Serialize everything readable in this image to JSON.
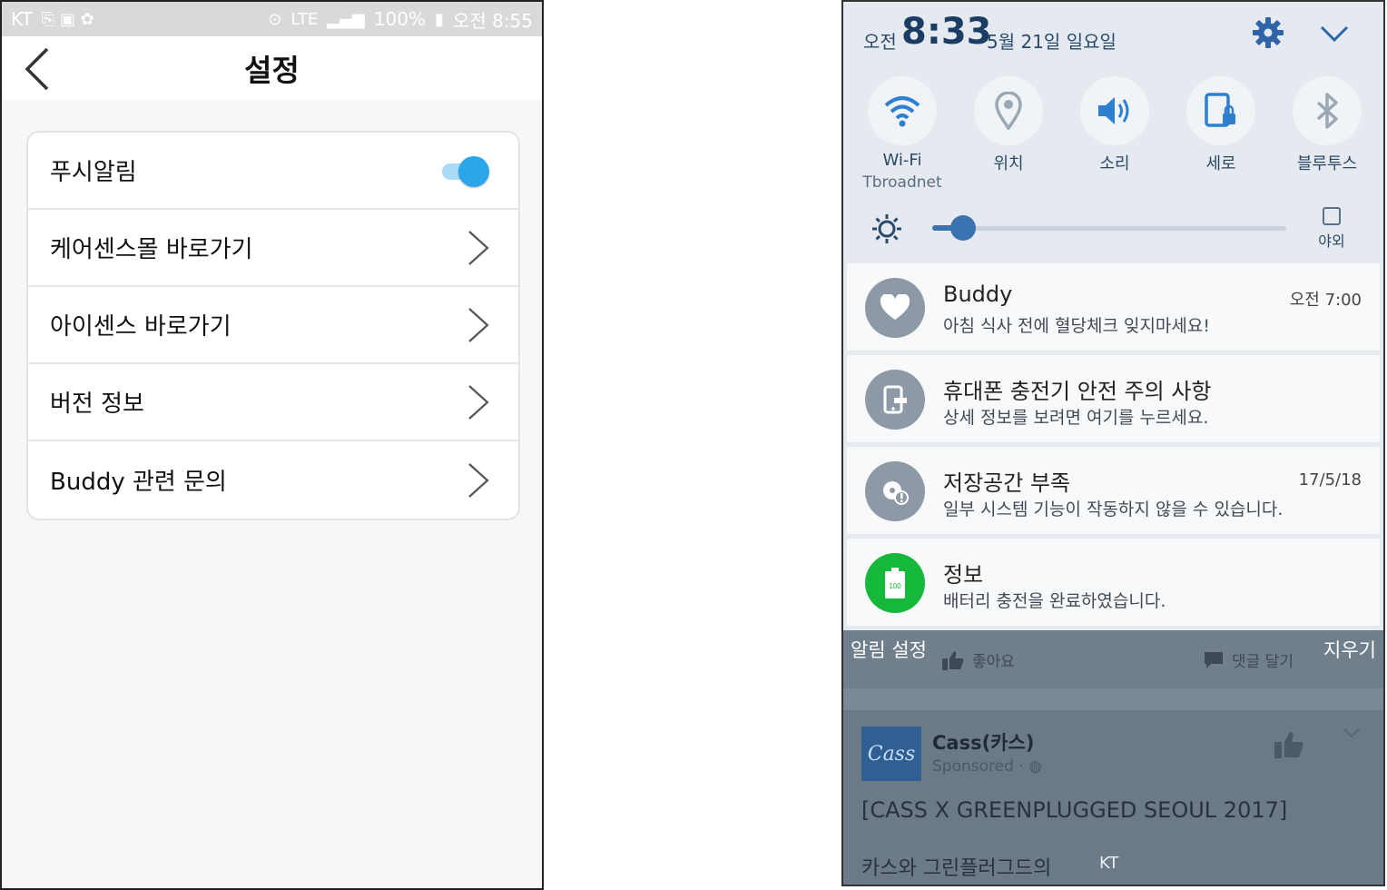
{
  "left_screen": {
    "statusbar": {
      "carrier": "KT",
      "battery": "100%",
      "time": "오전 8:55",
      "network": "LTE"
    },
    "appbar": {
      "title": "설정"
    },
    "settings": [
      {
        "label": "푸시알림",
        "type": "toggle",
        "state": "on"
      },
      {
        "label": "케어센스몰 바로가기",
        "type": "link"
      },
      {
        "label": "아이센스 바로가기",
        "type": "link"
      },
      {
        "label": "버전 정보",
        "type": "link"
      },
      {
        "label": "Buddy 관련 문의",
        "type": "link"
      }
    ],
    "accent_color": "#2ba6ea"
  },
  "right_screen": {
    "header": {
      "ampm": "오전",
      "time": "8:33",
      "date": "5월 21일 일요일"
    },
    "quick_settings": [
      {
        "label": "Wi-Fi",
        "sub": "Tbroadnet",
        "icon": "wifi-icon",
        "active": true
      },
      {
        "label": "위치",
        "sub": "",
        "icon": "location-icon",
        "active": false
      },
      {
        "label": "소리",
        "sub": "",
        "icon": "sound-icon",
        "active": true
      },
      {
        "label": "세로",
        "sub": "",
        "icon": "rotation-lock-icon",
        "active": true
      },
      {
        "label": "블루투스",
        "sub": "",
        "icon": "bluetooth-icon",
        "active": false
      }
    ],
    "brightness": {
      "level": 0.09,
      "outdoor_label": "야외",
      "outdoor_checked": false
    },
    "notifications": [
      {
        "title": "Buddy",
        "body": "아침 식사 전에 혈당체크 잊지마세요!",
        "time": "오전 7:00",
        "icon": "heart-icon"
      },
      {
        "title": "휴대폰 충전기 안전 주의 사항",
        "body": "상세 정보를 보려면 여기를 누르세요.",
        "time": "",
        "icon": "charger-icon"
      },
      {
        "title": "저장공간 부족",
        "body": "일부 시스템 기능이 작동하지 않을 수 있습니다.",
        "time": "17/5/18",
        "icon": "storage-warning-icon"
      },
      {
        "title": "정보",
        "body": "배터리 충전을 완료하였습니다.",
        "time": "",
        "icon": "battery-full-icon"
      }
    ],
    "footer": {
      "settings_label": "알림 설정",
      "clear_label": "지우기",
      "like_label": "좋아요",
      "comment_label": "댓글 달기"
    },
    "background_post": {
      "logo_text": "Cass",
      "name": "Cass(카스)",
      "sponsored": "Sponsored · ",
      "headline": "[CASS X GREENPLUGGED SEOUL 2017]",
      "subline": "카스와 그린플러그드의",
      "carrier": "KT"
    }
  }
}
